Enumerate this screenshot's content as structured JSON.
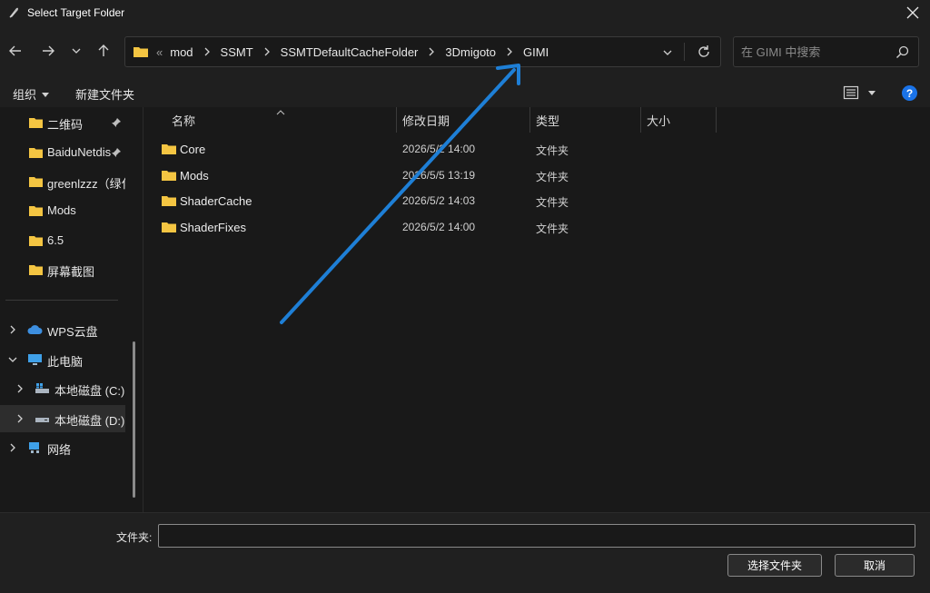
{
  "window": {
    "title": "Select Target Folder"
  },
  "nav": {
    "breadcrumbs": [
      "mod",
      "SSMT",
      "SSMTDefaultCacheFolder",
      "3Dmigoto",
      "GIMI"
    ],
    "overflow": "«",
    "search_placeholder": "在 GIMI 中搜索"
  },
  "toolbar": {
    "organize": "组织",
    "new_folder": "新建文件夹"
  },
  "sidebar": {
    "quick_access": [
      {
        "label": "二维码",
        "pinned": true
      },
      {
        "label": "BaiduNetdisk",
        "pinned": true
      },
      {
        "label": "greenlzzz（绿化",
        "pinned": false
      },
      {
        "label": "Mods",
        "pinned": false
      },
      {
        "label": "6.5",
        "pinned": false
      },
      {
        "label": "屏幕截图",
        "pinned": false
      }
    ],
    "tree": [
      {
        "label": "WPS云盘",
        "icon": "cloud-icon"
      },
      {
        "label": "此电脑",
        "icon": "computer-icon"
      },
      {
        "label": "本地磁盘 (C:)",
        "icon": "drive-icon"
      },
      {
        "label": "本地磁盘 (D:)",
        "icon": "drive-icon"
      },
      {
        "label": "网络",
        "icon": "network-icon"
      }
    ]
  },
  "columns": {
    "name": "名称",
    "date": "修改日期",
    "type": "类型",
    "size": "大小"
  },
  "files": [
    {
      "name": "Core",
      "date": "2026/5/2 14:00",
      "type": "文件夹"
    },
    {
      "name": "Mods",
      "date": "2026/5/5 13:19",
      "type": "文件夹"
    },
    {
      "name": "ShaderCache",
      "date": "2026/5/2 14:03",
      "type": "文件夹"
    },
    {
      "name": "ShaderFixes",
      "date": "2026/5/2 14:00",
      "type": "文件夹"
    }
  ],
  "footer": {
    "folder_label": "文件夹:",
    "folder_value": "",
    "ok_label": "选择文件夹",
    "cancel_label": "取消"
  },
  "colors": {
    "accent": "#1a73e8",
    "folder": "#f4c542",
    "annotation_arrow": "#1e7fd6"
  }
}
